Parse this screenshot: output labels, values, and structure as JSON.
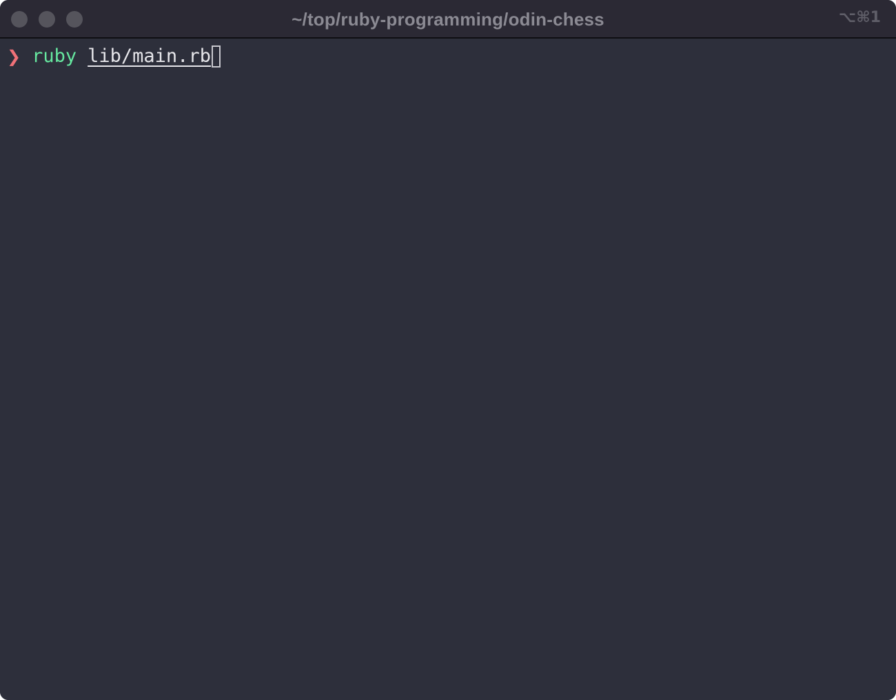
{
  "window": {
    "title": "~/top/ruby-programming/odin-chess",
    "shortcut": "⌥⌘1",
    "controls": {
      "close": "close-button",
      "minimize": "minimize-button",
      "zoom": "zoom-button"
    }
  },
  "terminal": {
    "prompt_symbol": "❯",
    "command": "ruby",
    "argument": "lib/main.rb"
  },
  "colors": {
    "background": "#2d2f3b",
    "titlebar": "#2b2934",
    "prompt": "#f07178",
    "command": "#66e8a0",
    "argument": "#e6e6ea"
  }
}
